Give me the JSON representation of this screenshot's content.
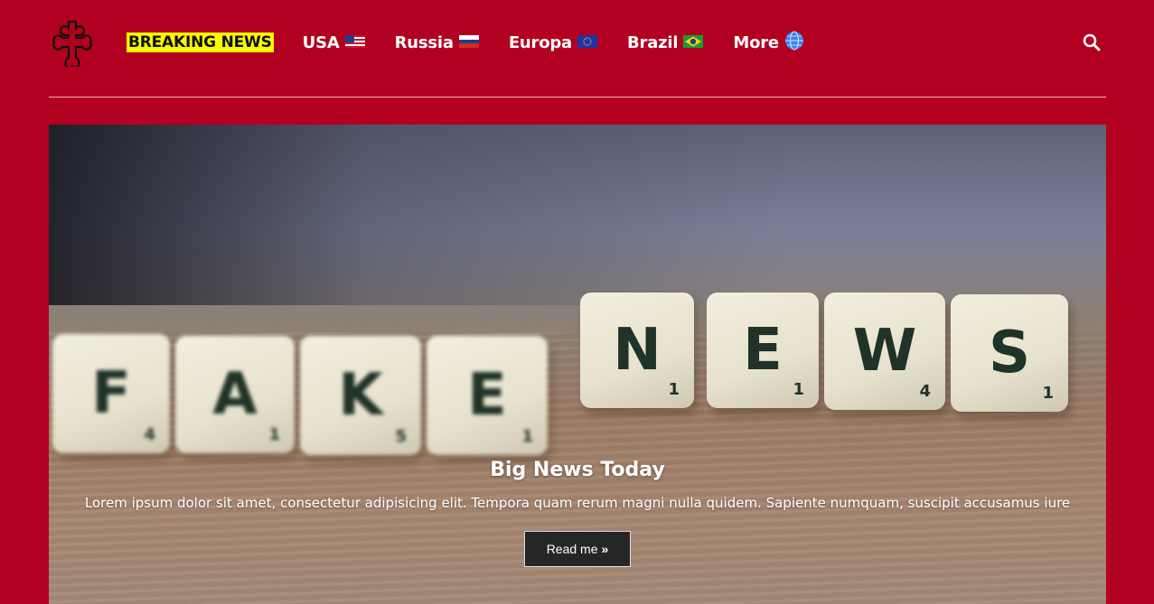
{
  "header": {
    "logo_icon": "cross-icon",
    "nav": [
      {
        "label": "BREAKING NEWS",
        "flag": ""
      },
      {
        "label": "USA",
        "flag": "🇺🇸"
      },
      {
        "label": "Russia",
        "flag": "🇷🇺"
      },
      {
        "label": "Europa",
        "flag": "🇪🇺"
      },
      {
        "label": "Brazil",
        "flag": "🇧🇷"
      },
      {
        "label": "More",
        "flag": "🌐"
      }
    ],
    "search_icon": "search-icon"
  },
  "hero": {
    "tiles": [
      {
        "letter": "F",
        "score": "4"
      },
      {
        "letter": "A",
        "score": "1"
      },
      {
        "letter": "K",
        "score": "5"
      },
      {
        "letter": "E",
        "score": "1"
      },
      {
        "letter": "N",
        "score": "1"
      },
      {
        "letter": "E",
        "score": "1"
      },
      {
        "letter": "W",
        "score": "4"
      },
      {
        "letter": "S",
        "score": "1"
      }
    ],
    "title": "Big News Today",
    "text": "Lorem ipsum dolor sit amet, consectetur adipisicing elit. Tempora quam rerum magni nulla quidem. Sapiente numquam, suscipit accusamus iure",
    "button_label": "Read me",
    "button_icon": "double-chevron-right-icon"
  },
  "colors": {
    "background": "#b20020",
    "highlight": "#fafa00",
    "button": "#262626"
  }
}
